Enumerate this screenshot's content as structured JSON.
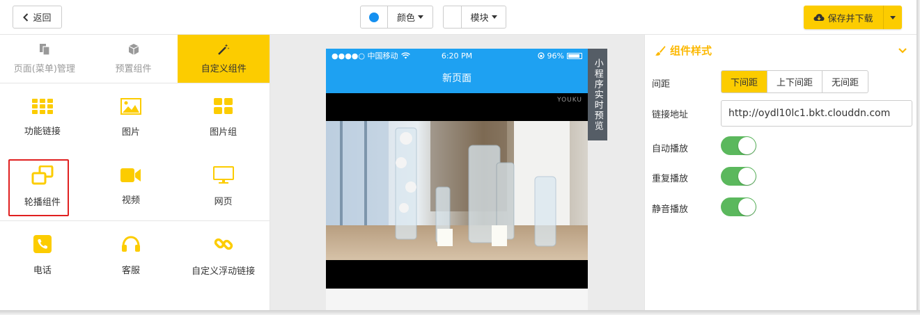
{
  "toolbar": {
    "back_label": "返回",
    "color_label": "颜色",
    "color_value": "#1590f0",
    "module_label": "模块",
    "save_label": "保存并下载"
  },
  "left_panel": {
    "tabs": [
      {
        "label": "页面(菜单)管理",
        "icon": "file-copy-icon",
        "active": false
      },
      {
        "label": "预置组件",
        "icon": "cube-icon",
        "active": false
      },
      {
        "label": "自定义组件",
        "icon": "magic-wand-icon",
        "active": true
      }
    ],
    "components": [
      {
        "label": "功能链接",
        "icon": "grid-icon"
      },
      {
        "label": "图片",
        "icon": "image-icon"
      },
      {
        "label": "图片组",
        "icon": "tiles-icon"
      },
      {
        "label": "轮播组件",
        "icon": "carousel-icon",
        "highlighted": true
      },
      {
        "label": "视频",
        "icon": "video-camera-icon"
      },
      {
        "label": "网页",
        "icon": "monitor-icon"
      },
      {
        "label": "电话",
        "icon": "phone-icon"
      },
      {
        "label": "客服",
        "icon": "headset-icon"
      },
      {
        "label": "自定义浮动链接",
        "icon": "link-icon"
      }
    ]
  },
  "phone": {
    "carrier": "●●●●○ 中国移动",
    "time": "6:20 PM",
    "battery": "96%",
    "page_title": "新页面",
    "watermark": "YOUKU",
    "preview_tab": "小程序实时预览"
  },
  "right_panel": {
    "section_title": "组件样式",
    "spacing_label": "间距",
    "spacing_options": [
      "下间距",
      "上下间距",
      "无间距"
    ],
    "spacing_selected": "下间距",
    "link_label": "链接地址",
    "link_value": "http://oydl10lc1.bkt.clouddn.com",
    "autoplay_label": "自动播放",
    "autoplay_on": true,
    "loop_label": "重复播放",
    "loop_on": true,
    "mute_label": "静音播放",
    "mute_on": true
  },
  "colors": {
    "accent": "#fccc00",
    "phone_blue": "#1ea1f2",
    "toggle_on": "#5bb85d",
    "highlight_border": "#e02020"
  }
}
